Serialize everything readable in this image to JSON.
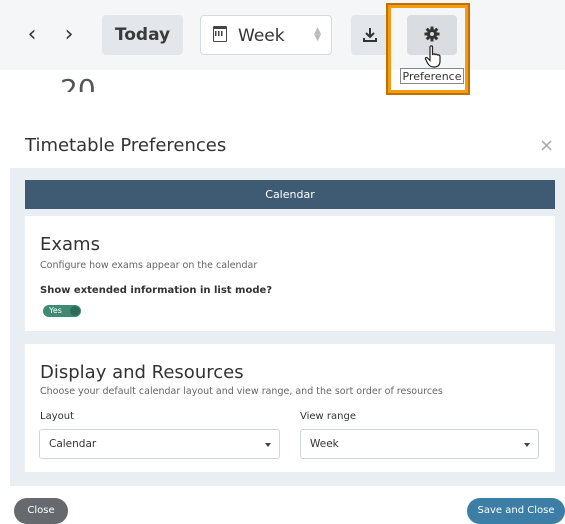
{
  "toolbar": {
    "today_label": "Today",
    "view_select_value": "Week",
    "preference_tooltip": "Preference"
  },
  "date_fragment": "20",
  "modal": {
    "title": "Timetable Preferences",
    "close_glyph": "×",
    "tab_label": "Calendar",
    "exams": {
      "heading": "Exams",
      "description": "Configure how exams appear on the calendar",
      "question": "Show extended information in list mode?",
      "toggle_label": "Yes",
      "toggle_on": true
    },
    "display": {
      "heading": "Display and Resources",
      "description": "Choose your default calendar layout and view range, and the sort order of resources",
      "layout_label": "Layout",
      "layout_value": "Calendar",
      "view_range_label": "View range",
      "view_range_value": "Week"
    },
    "close_button": "Close",
    "save_button": "Save and Close"
  },
  "colors": {
    "accent_orange": "#f39c12",
    "header_bar": "#3e5b73",
    "toggle_green": "#3f8a73",
    "save_blue": "#3d7ea6",
    "close_grey": "#666a6e"
  }
}
